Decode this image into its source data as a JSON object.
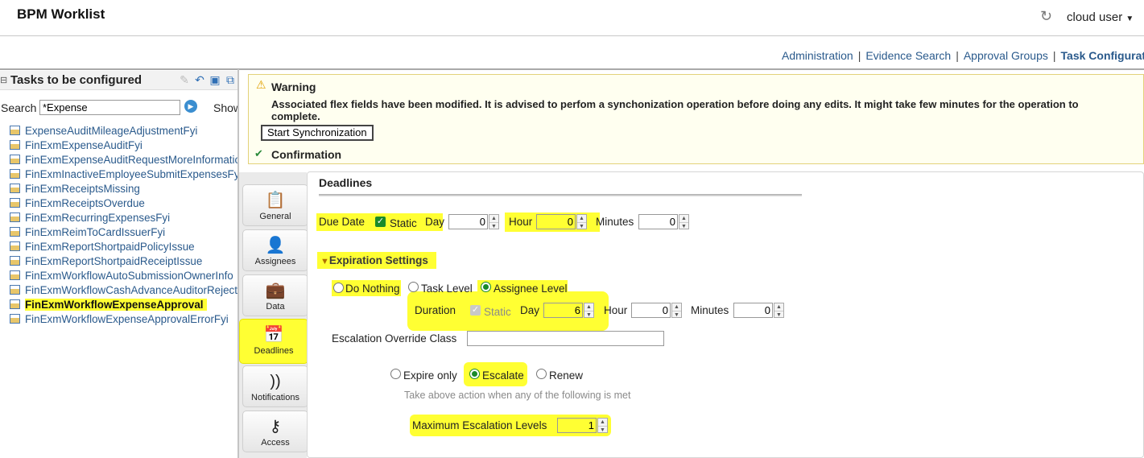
{
  "app": {
    "title": "BPM Worklist",
    "user": "cloud user"
  },
  "nav": {
    "links": [
      "Administration",
      "Evidence Search",
      "Approval Groups"
    ],
    "active": "Task Configuration"
  },
  "left_panel": {
    "title": "Tasks to be configured",
    "search_label": "Search",
    "search_value": "*Expense",
    "show_label": "Show",
    "tasks": [
      "ExpenseAuditMileageAdjustmentFyi",
      "FinExmExpenseAuditFyi",
      "FinExmExpenseAuditRequestMoreInformation",
      "FinExmInactiveEmployeeSubmitExpensesFyi",
      "FinExmReceiptsMissing",
      "FinExmReceiptsOverdue",
      "FinExmRecurringExpensesFyi",
      "FinExmReimToCardIssuerFyi",
      "FinExmReportShortpaidPolicyIssue",
      "FinExmReportShortpaidReceiptIssue",
      "FinExmWorkflowAutoSubmissionOwnerInfo",
      "FinExmWorkflowCashAdvanceAuditorReject",
      "FinExmWorkflowExpenseApproval",
      "FinExmWorkflowExpenseApprovalErrorFyi"
    ],
    "selected_index": 12
  },
  "warning": {
    "title": "Warning",
    "message": "Associated flex fields have been modified. It is advised to perfom a synchonization operation before doing any edits. It might take few minutes for the operation to complete.",
    "button": "Start Synchronization",
    "confirmation": "Confirmation"
  },
  "tabs": [
    {
      "label": "General",
      "icon": "clipboard-check-icon"
    },
    {
      "label": "Assignees",
      "icon": "person-icon"
    },
    {
      "label": "Data",
      "icon": "briefcase-icon"
    },
    {
      "label": "Deadlines",
      "icon": "calendar-icon",
      "active": true
    },
    {
      "label": "Notifications",
      "icon": "rss-icon"
    },
    {
      "label": "Access",
      "icon": "key-icon"
    }
  ],
  "deadlines": {
    "title": "Deadlines",
    "due_date": {
      "label": "Due Date",
      "static_label": "Static",
      "static_checked": true,
      "day_label": "Day",
      "day_value": "0",
      "hour_label": "Hour",
      "hour_value": "0",
      "minutes_label": "Minutes",
      "minutes_value": "0"
    },
    "expiration": {
      "title": "Expiration Settings",
      "options": [
        "Do Nothing",
        "Task Level",
        "Assignee Level"
      ],
      "selected": "Assignee Level",
      "duration_label": "Duration",
      "static_label": "Static",
      "day_label": "Day",
      "day_value": "6",
      "hour_label": "Hour",
      "hour_value": "0",
      "minutes_label": "Minutes",
      "minutes_value": "0",
      "override_label": "Escalation Override Class",
      "override_value": "",
      "actions": [
        "Expire only",
        "Escalate",
        "Renew"
      ],
      "action_selected": "Escalate",
      "hint": "Take above action when any of the following is met",
      "max_levels_label": "Maximum Escalation Levels",
      "max_levels_value": "1"
    }
  }
}
